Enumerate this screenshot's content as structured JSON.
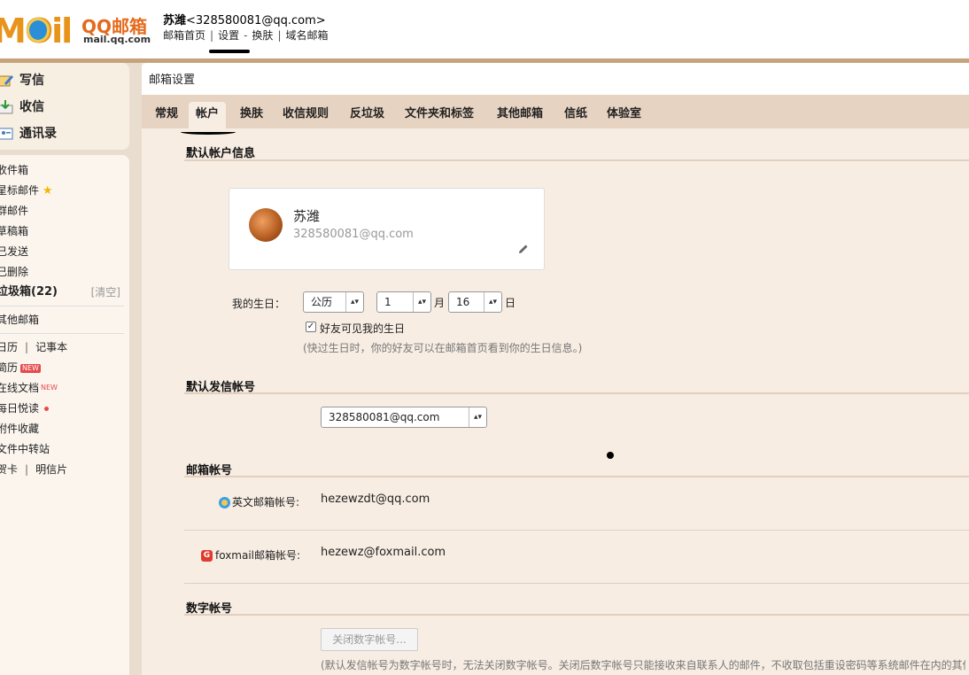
{
  "header": {
    "logo_text": "MOil",
    "logo_qq": "QQ邮箱",
    "logo_domain": "mail.qq.com",
    "user_name": "苏潍",
    "user_email": "<328580081@qq.com>",
    "links": [
      "邮箱首页",
      "设置",
      "换肤",
      "域名邮箱"
    ]
  },
  "sidebar": {
    "primary": [
      {
        "label": "写信",
        "icon": "pen-icon"
      },
      {
        "label": "收信",
        "icon": "inbox-icon"
      },
      {
        "label": "通讯录",
        "icon": "contacts-icon"
      }
    ],
    "folders": [
      "收件箱",
      "星标邮件",
      "群邮件",
      "草稿箱",
      "已发送",
      "已删除"
    ],
    "trash_label": "垃圾箱(22)",
    "trash_clear": "[清空]",
    "other_mail": "其他邮箱",
    "calendar": "日历",
    "notes": "记事本",
    "resume": "简历",
    "new_tag": "NEW",
    "online_docs": "在线文档",
    "daily_read": "每日悦读",
    "attachments": "附件收藏",
    "file_transfer": "文件中转站",
    "greeting_card": "贺卡",
    "postcard": "明信片"
  },
  "main": {
    "title": "邮箱设置",
    "tabs": [
      "常规",
      "帐户",
      "换肤",
      "收信规则",
      "反垃圾",
      "文件夹和标签",
      "其他邮箱",
      "信纸",
      "体验室"
    ],
    "active_tab": "帐户",
    "section_default_account": "默认帐户信息",
    "card_name": "苏潍",
    "card_email": "328580081@qq.com",
    "birthday_label": "我的生日：",
    "birthday_calendar": "公历",
    "birthday_month": "1",
    "month_unit": "月",
    "birthday_day": "16",
    "day_unit": "日",
    "friends_visible": "好友可见我的生日",
    "birthday_hint": "(快过生日时，你的好友可以在邮箱首页看到你的生日信息。)",
    "section_default_sender": "默认发信帐号",
    "default_sender": "328580081@qq.com",
    "section_mail_accounts": "邮箱帐号",
    "english_label": "英文邮箱帐号:",
    "english_value": "hezewzdt@qq.com",
    "foxmail_label": "foxmail邮箱帐号:",
    "foxmail_value": "hezewz@foxmail.com",
    "section_numeric": "数字帐号",
    "close_numeric_btn": "关闭数字帐号...",
    "numeric_hint": "(默认发信帐号为数字帐号时，无法关闭数字帐号。关闭后数字帐号只能接收来自联系人的邮件，不收取包括重设密码等系统邮件在内的其他"
  },
  "colors": {
    "accent_orange": "#e8941b",
    "tab_bar": "#e6d3c1",
    "panel_bg": "#f7ede3",
    "new_red": "#e54b4b"
  }
}
